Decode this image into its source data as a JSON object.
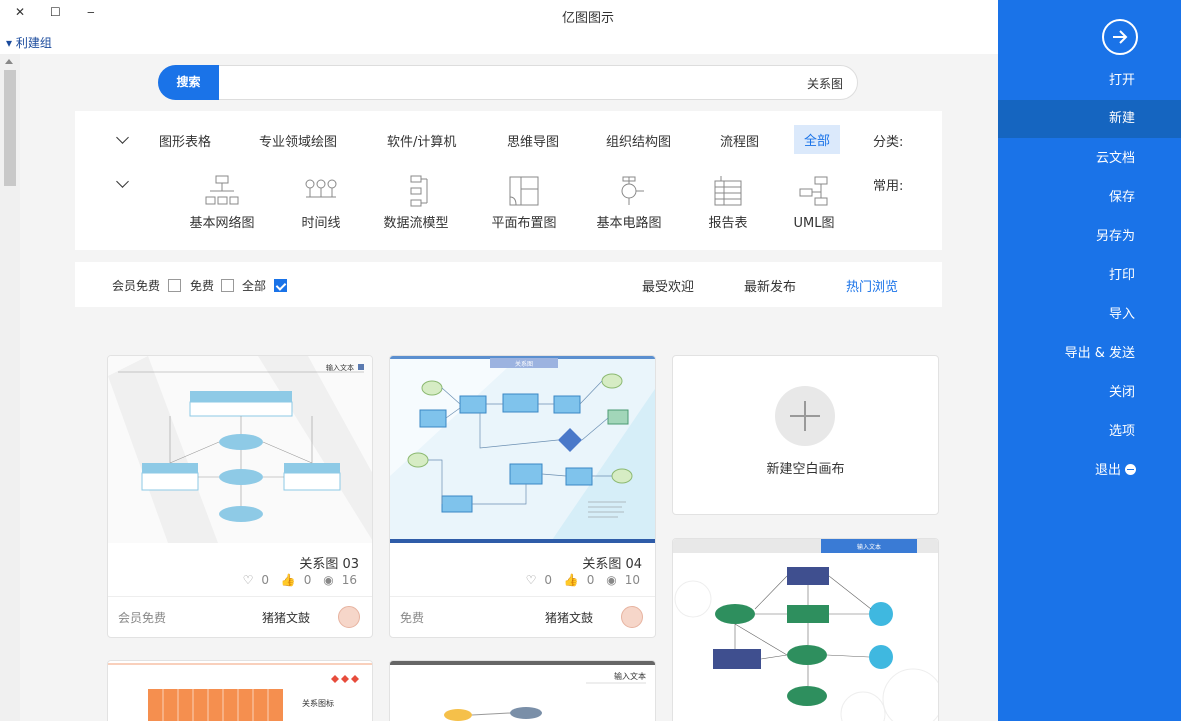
{
  "window": {
    "title": "亿图图示",
    "menu_label": "利建组"
  },
  "sidebar": {
    "items": [
      {
        "label": "打开"
      },
      {
        "label": "新建"
      },
      {
        "label": "云文档"
      },
      {
        "label": "保存"
      },
      {
        "label": "另存为"
      },
      {
        "label": "打印"
      },
      {
        "label": "导入"
      },
      {
        "label": "导出 & 发送"
      },
      {
        "label": "关闭"
      },
      {
        "label": "选项"
      },
      {
        "label": "退出"
      }
    ],
    "selected": "新建"
  },
  "search": {
    "button_label": "搜索",
    "query": "关系图"
  },
  "categories": {
    "label": "分类:",
    "items": [
      "全部",
      "流程图",
      "组织结构图",
      "思维导图",
      "软件/计算机",
      "专业领域绘图",
      "图形表格"
    ],
    "selected": "全部"
  },
  "common": {
    "label": "常用:",
    "items": [
      "UML图",
      "报告表",
      "基本电路图",
      "平面布置图",
      "数据流模型",
      "时间线",
      "基本网络图"
    ]
  },
  "filters": {
    "tabs": [
      "热门浏览",
      "最新发布",
      "最受欢迎"
    ],
    "selected_tab": "热门浏览",
    "checks": [
      {
        "label": "全部",
        "checked": true
      },
      {
        "label": "免费",
        "checked": false
      },
      {
        "label": "会员免费",
        "checked": false
      }
    ]
  },
  "new_canvas": {
    "label": "新建空白画布"
  },
  "cards": [
    {
      "title": "关系图 04",
      "views": "10",
      "likes": "0",
      "favorites": "0",
      "author": "猪猪文鼓",
      "price": "免费",
      "thumb_heading": "关系图"
    },
    {
      "title": "关系图 03",
      "views": "16",
      "likes": "0",
      "favorites": "0",
      "author": "猪猪文鼓",
      "price": "会员免费",
      "thumb_heading": "输入文本"
    }
  ],
  "partial_cards": [
    {
      "thumb_heading": "输入文本"
    },
    {
      "thumb_heading": "输入文本"
    },
    {
      "thumb_heading": "关系图标"
    }
  ],
  "colors": {
    "accent": "#1a73e8",
    "sidebar": "#1a73e8",
    "sidebar_selected": "#1565c0"
  }
}
